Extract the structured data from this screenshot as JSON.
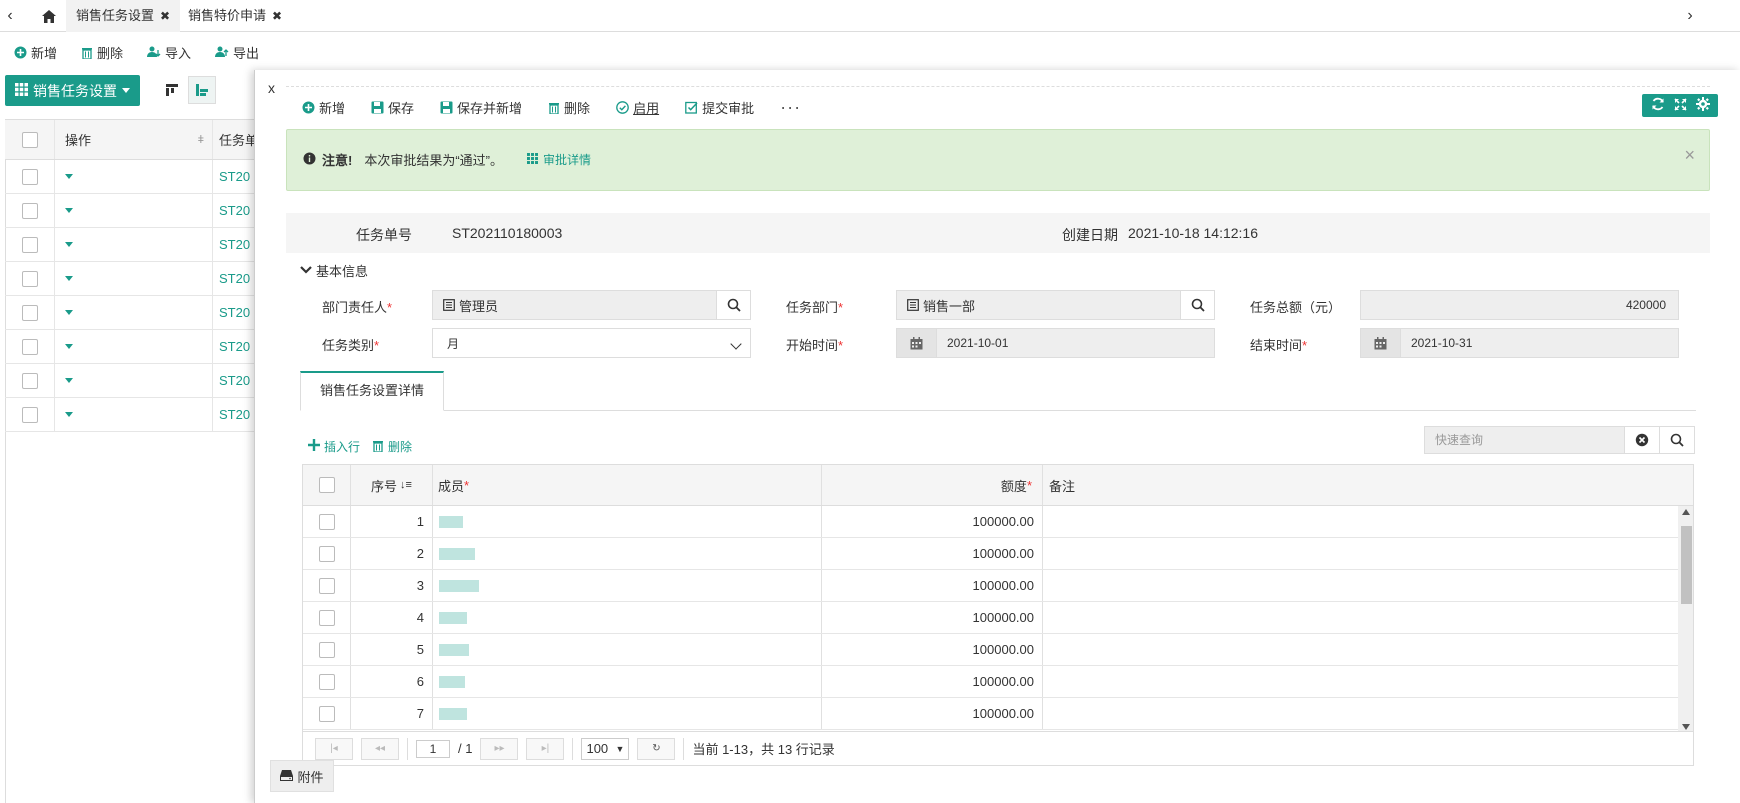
{
  "tabs": {
    "home": "home",
    "items": [
      {
        "label": "销售任务设置",
        "active": true
      },
      {
        "label": "销售特价申请",
        "active": false
      }
    ]
  },
  "bg_toolbar": {
    "add": "新增",
    "delete": "删除",
    "import": "导入",
    "export": "导出"
  },
  "bg_main_button": "销售任务设置",
  "bg_table": {
    "headers": {
      "op": "操作",
      "code": "任务单"
    },
    "rows": [
      "ST20",
      "ST20",
      "ST20",
      "ST20",
      "ST20",
      "ST20",
      "ST20",
      "ST20"
    ]
  },
  "panel": {
    "close": "x",
    "toolbar": {
      "add": "新增",
      "save": "保存",
      "save_new": "保存并新增",
      "delete": "删除",
      "enable": "启用",
      "submit": "提交审批",
      "more": "···"
    },
    "alert": {
      "title": "注意!",
      "message": "本次审批结果为“通过”。",
      "detail": "审批详情",
      "close": "×"
    },
    "info": {
      "task_no_label": "任务单号",
      "task_no": "ST202110180003",
      "created_label": "创建日期",
      "created": "2021-10-18 14:12:16"
    },
    "section": "基本信息",
    "form": {
      "owner_label": "部门责任人",
      "owner": "管理员",
      "dept_label": "任务部门",
      "dept": "销售一部",
      "total_label": "任务总额（元）",
      "total": "420000",
      "type_label": "任务类别",
      "type": "月",
      "start_label": "开始时间",
      "start": "2021-10-01",
      "end_label": "结束时间",
      "end": "2021-10-31"
    },
    "detail_tab": "销售任务设置详情",
    "sub_tools": {
      "insert": "插入行",
      "delete": "删除"
    },
    "quick_search_placeholder": "快速查询",
    "grid": {
      "headers": {
        "seq": "序号",
        "member": "成员",
        "amount": "额度",
        "remark": "备注"
      },
      "rows": [
        {
          "seq": "1",
          "amount": "100000.00"
        },
        {
          "seq": "2",
          "amount": "100000.00"
        },
        {
          "seq": "3",
          "amount": "100000.00"
        },
        {
          "seq": "4",
          "amount": "100000.00"
        },
        {
          "seq": "5",
          "amount": "100000.00"
        },
        {
          "seq": "6",
          "amount": "100000.00"
        },
        {
          "seq": "7",
          "amount": "100000.00"
        }
      ]
    },
    "pager": {
      "page": "1",
      "total_pages": "/ 1",
      "page_size": "100",
      "summary": "当前 1-13，共 13 行记录"
    },
    "attachment": "附件"
  },
  "colors": {
    "accent": "#1a9b8a",
    "alert_bg": "#dff0d8"
  }
}
